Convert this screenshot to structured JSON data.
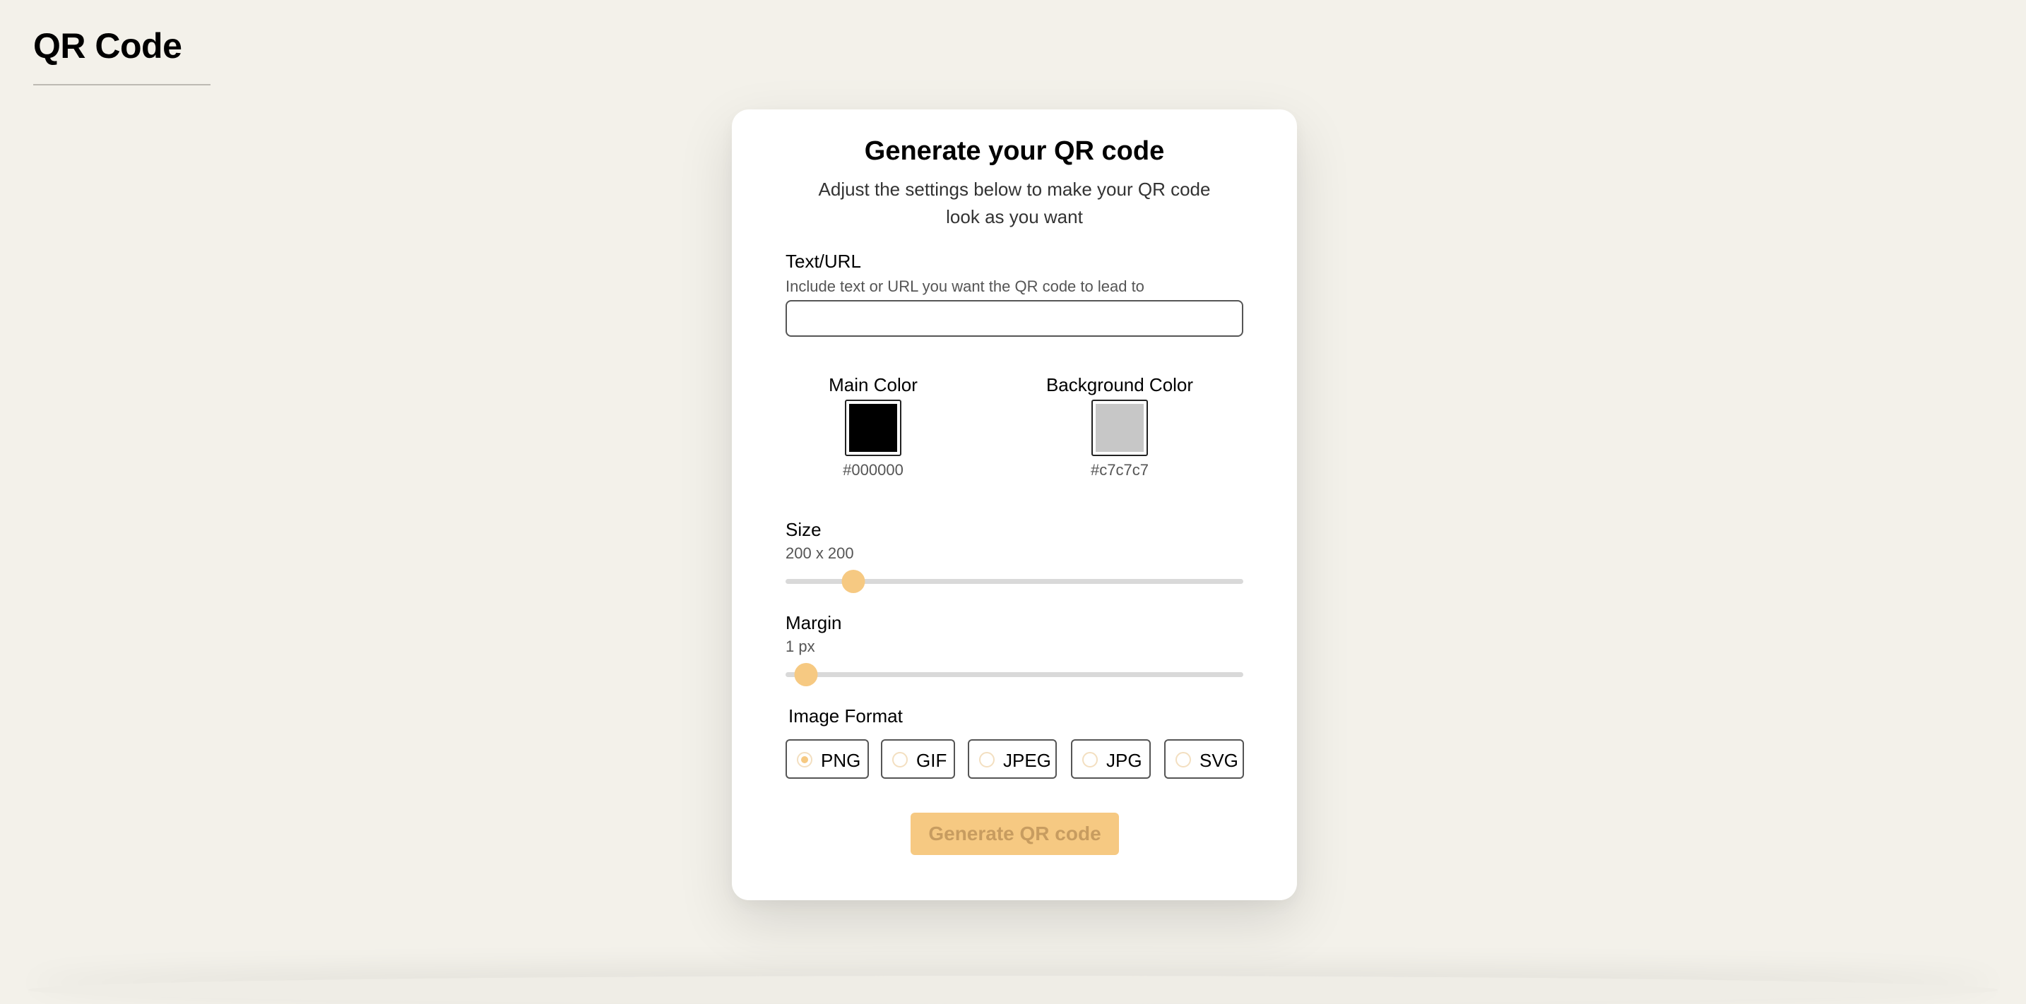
{
  "app": {
    "title": "QR Code"
  },
  "form": {
    "title": "Generate your QR code",
    "subtitle": "Adjust the settings below to make your QR code look as you want",
    "text_url": {
      "label": "Text/URL",
      "help": "Include text or URL you want the QR code to lead to",
      "value": "",
      "placeholder": ""
    },
    "main_color": {
      "label": "Main Color",
      "value": "#000000"
    },
    "background_color": {
      "label": "Background Color",
      "value": "#c7c7c7"
    },
    "size": {
      "label": "Size",
      "value_text": "200 x 200",
      "level": 0.13
    },
    "margin": {
      "label": "Margin",
      "value_text": "1 px",
      "level": 0.02
    },
    "image_format": {
      "label": "Image Format",
      "selected": "PNG",
      "options": [
        "PNG",
        "GIF",
        "JPEG",
        "JPG",
        "SVG"
      ]
    },
    "generate_label": "Generate QR code"
  },
  "colors": {
    "accent": "#f6c982",
    "page_background": "#f3f1ea",
    "card_background": "#ffffff"
  }
}
